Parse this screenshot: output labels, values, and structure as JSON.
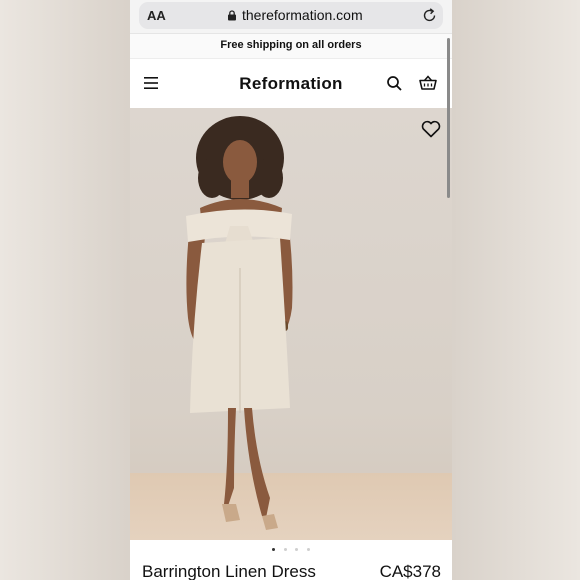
{
  "browser": {
    "text_size_label": "AA",
    "url": "thereformation.com"
  },
  "promo_banner": {
    "text": "Free shipping on all orders"
  },
  "header": {
    "brand": "Reformation",
    "icons": [
      "menu-icon",
      "search-icon",
      "shopping-bag-icon"
    ]
  },
  "product": {
    "name": "Barrington Linen Dress",
    "price": "CA$378",
    "image_description_icon": "heart-icon",
    "carousel": {
      "total": 4,
      "active": 1
    }
  },
  "colors": {
    "accent": "#111111",
    "background_wall": "#ddd6cf",
    "floor": "#dfc9b2"
  }
}
